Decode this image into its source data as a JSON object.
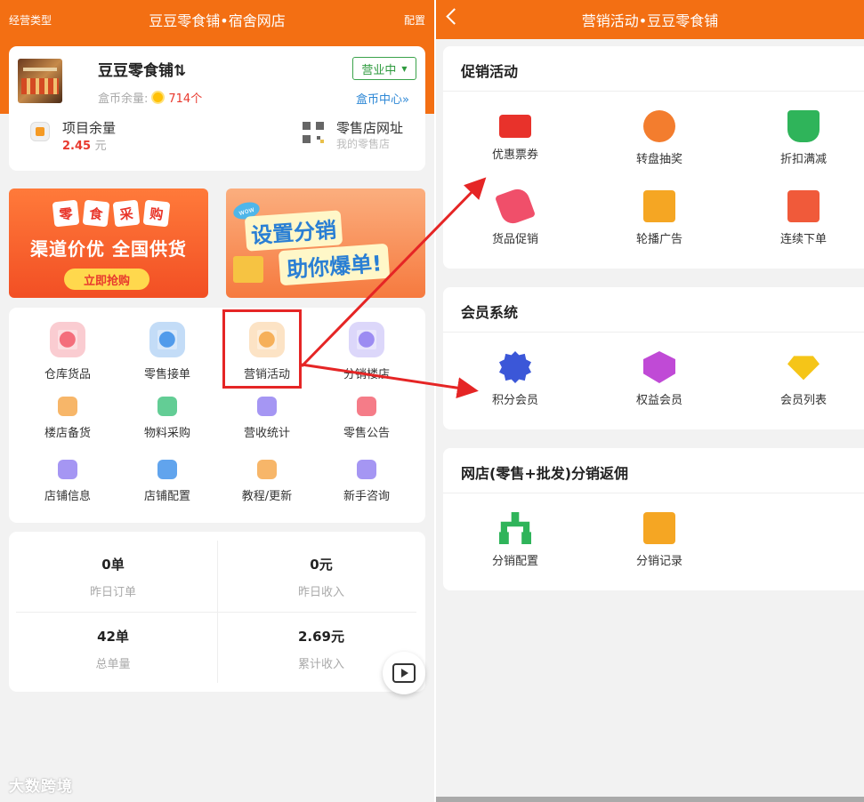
{
  "left": {
    "header": {
      "left": "经营类型",
      "title": "豆豆零食铺•宿舍网店",
      "right": "配置"
    },
    "store": {
      "name": "豆豆零食铺⇅",
      "coin_label": "盒币余量:",
      "coin_value": "714个",
      "status": "营业中",
      "coin_center": "盒币中心»",
      "project_label": "项目余量",
      "project_value": "2.45",
      "project_unit": "元",
      "shop_label": "零售店网址",
      "shop_sub": "我的零售店"
    },
    "banner1": {
      "tiles": [
        "零",
        "食",
        "采",
        "购"
      ],
      "line": "渠道价优 全国供货",
      "button": "立即抢购"
    },
    "banner2": {
      "tag": "wow",
      "line1": "设置分销",
      "line2": "助你爆单!"
    },
    "functions": [
      {
        "label": "仓库货品",
        "color": "#f25b6a"
      },
      {
        "label": "零售接单",
        "color": "#3a8de8"
      },
      {
        "label": "营销活动",
        "color": "#f5a443"
      },
      {
        "label": "分销楼店",
        "color": "#8e7cf0"
      },
      {
        "label": "楼店备货",
        "color": "#f5a443"
      },
      {
        "label": "物料采购",
        "color": "#3cc07a"
      },
      {
        "label": "营收统计",
        "color": "#8e7cf0"
      },
      {
        "label": "零售公告",
        "color": "#f25b6a"
      },
      {
        "label": "店铺信息",
        "color": "#8e7cf0"
      },
      {
        "label": "店铺配置",
        "color": "#3a8de8"
      },
      {
        "label": "教程/更新",
        "color": "#f5a443"
      },
      {
        "label": "新手咨询",
        "color": "#8e7cf0"
      }
    ],
    "stats": [
      {
        "value": "0单",
        "label": "昨日订单"
      },
      {
        "value": "0元",
        "label": "昨日收入"
      },
      {
        "value": "42单",
        "label": "总单量"
      },
      {
        "value": "2.69元",
        "label": "累计收入"
      }
    ],
    "watermark": "大数跨境"
  },
  "right": {
    "header": {
      "title": "营销活动•豆豆零食铺"
    },
    "sections": [
      {
        "title": "促销活动",
        "items": [
          {
            "label": "优惠票券",
            "icon": "coupon-icon",
            "color": "#e8322b"
          },
          {
            "label": "转盘抽奖",
            "icon": "wheel-icon",
            "color": "#f37d2e"
          },
          {
            "label": "折扣满减",
            "icon": "discount-icon",
            "color": "#2fb45a"
          },
          {
            "label": "货品促销",
            "icon": "promo-tag-icon",
            "color": "#f04f6a"
          },
          {
            "label": "轮播广告",
            "icon": "ad-icon",
            "color": "#f5a623"
          },
          {
            "label": "连续下单",
            "icon": "gift-icon",
            "color": "#f05a3a"
          }
        ]
      },
      {
        "title": "会员系统",
        "items": [
          {
            "label": "积分会员",
            "icon": "points-badge-icon",
            "color": "#3b57d8"
          },
          {
            "label": "权益会员",
            "icon": "vip-medal-icon",
            "color": "#c04ad6"
          },
          {
            "label": "会员列表",
            "icon": "diamond-icon",
            "color": "#f5c518"
          }
        ]
      },
      {
        "title": "网店(零售+批发)分销返佣",
        "items": [
          {
            "label": "分销配置",
            "icon": "hierarchy-icon",
            "color": "#2fb45a"
          },
          {
            "label": "分销记录",
            "icon": "record-icon",
            "color": "#f5a623"
          }
        ]
      }
    ]
  },
  "annotations": {
    "highlight_color": "#e52525"
  }
}
